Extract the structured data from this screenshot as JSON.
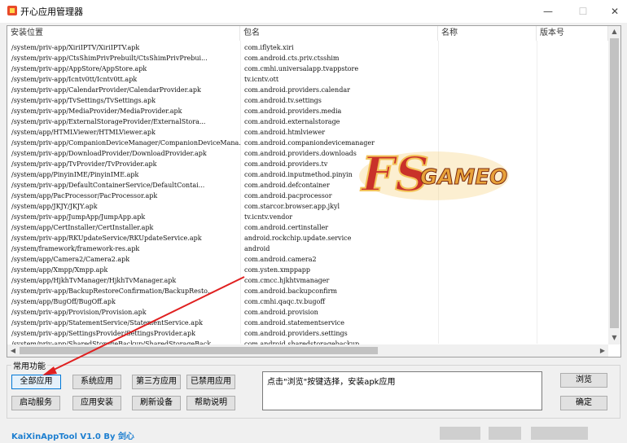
{
  "window": {
    "title": "开心应用管理器",
    "minimize": "—",
    "maximize": "☐",
    "close": "✕"
  },
  "columns": [
    "安装位置",
    "包名",
    "名称",
    "版本号"
  ],
  "rows": [
    [
      "/system/priv-app/XiriIPTV/XiriIPTV.apk",
      "com.iflytek.xiri"
    ],
    [
      "/system/priv-app/CtsShimPrivPrebuilt/CtsShimPrivPrebui...",
      "com.android.cts.priv.ctsshim"
    ],
    [
      "/system/priv-app/AppStore/AppStore.apk",
      "com.cmhi.universalapp.tvappstore"
    ],
    [
      "/system/priv-app/Icntv0tt/Icntv0tt.apk",
      "tv.icntv.ott"
    ],
    [
      "/system/priv-app/CalendarProvider/CalendarProvider.apk",
      "com.android.providers.calendar"
    ],
    [
      "/system/priv-app/TvSettings/TvSettings.apk",
      "com.android.tv.settings"
    ],
    [
      "/system/priv-app/MediaProvider/MediaProvider.apk",
      "com.android.providers.media"
    ],
    [
      "/system/priv-app/ExternalStorageProvider/ExternalStora...",
      "com.android.externalstorage"
    ],
    [
      "/system/app/HTMLViewer/HTMLViewer.apk",
      "com.android.htmlviewer"
    ],
    [
      "/system/priv-app/CompanionDeviceManager/CompanionDeviceMana...",
      "com.android.companiondevicemanager"
    ],
    [
      "/system/priv-app/DownloadProvider/DownloadProvider.apk",
      "com.android.providers.downloads"
    ],
    [
      "/system/priv-app/TvProvider/TvProvider.apk",
      "com.android.providers.tv"
    ],
    [
      "/system/app/PinyinIME/PinyinIME.apk",
      "com.android.inputmethod.pinyin"
    ],
    [
      "/system/priv-app/DefaultContainerService/DefaultContai...",
      "com.android.defcontainer"
    ],
    [
      "/system/app/PacProcessor/PacProcessor.apk",
      "com.android.pacprocessor"
    ],
    [
      "/system/app/JKJY/JKJY.apk",
      "com.starcor.browser.app.jkyl"
    ],
    [
      "/system/priv-app/JumpApp/JumpApp.apk",
      "tv.icntv.vendor"
    ],
    [
      "/system/app/CertInstaller/CertInstaller.apk",
      "com.android.certinstaller"
    ],
    [
      "/system/priv-app/RKUpdateService/RKUpdateService.apk",
      "android.rockchip.update.service"
    ],
    [
      "/system/framework/framework-res.apk",
      "android"
    ],
    [
      "/system/app/Camera2/Camera2.apk",
      "com.android.camera2"
    ],
    [
      "/system/app/Xmpp/Xmpp.apk",
      "com.ysten.xmppapp"
    ],
    [
      "/system/app/HjkhTvManager/HjkhTvManager.apk",
      "com.cmcc.hjkhtvmanager"
    ],
    [
      "/system/priv-app/BackupRestoreConfirmation/BackupResto...",
      "com.android.backupconfirm"
    ],
    [
      "/system/app/BugOff/BugOff.apk",
      "com.cmhi.qaqc.tv.bugoff"
    ],
    [
      "/system/priv-app/Provision/Provision.apk",
      "com.android.provision"
    ],
    [
      "/system/priv-app/StatementService/StatementService.apk",
      "com.android.statementservice"
    ],
    [
      "/system/priv-app/SettingsProvider/SettingsProvider.apk",
      "com.android.providers.settings"
    ],
    [
      "/system/priv-app/SharedStorageBackup/SharedStorageBack...",
      "com.android.sharedstoragebackup"
    ]
  ],
  "group": {
    "label": "常用功能",
    "buttons": {
      "all_apps": "全部应用",
      "system_apps": "系统应用",
      "third_party": "第三方应用",
      "disabled": "已禁用应用",
      "start_service": "启动服务",
      "install_app": "应用安装",
      "refresh": "刷新设备",
      "help": "帮助说明",
      "browse": "浏览",
      "confirm": "确定"
    },
    "message": "点击\"浏览\"按键选择，安装apk应用"
  },
  "footer": "KaiXinAppTool V1.0 By 剑心",
  "watermark": {
    "letters": "FS",
    "text": "GAMEO"
  },
  "colors": {
    "accent": "#0078d7",
    "footer": "#1e7fd0",
    "arrow": "#e02020"
  }
}
